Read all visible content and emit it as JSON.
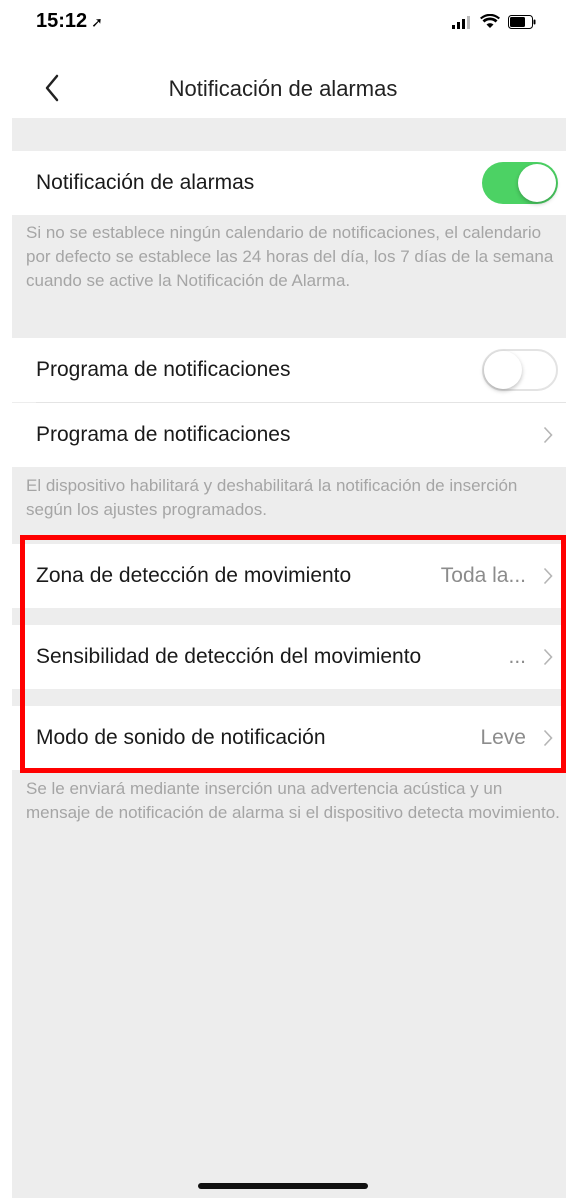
{
  "status_bar": {
    "time": "15:12",
    "location_arrow": "➚"
  },
  "nav": {
    "title": "Notificación de alarmas",
    "back_icon": "chevron-left-icon"
  },
  "sections": {
    "alarm_notification": {
      "label": "Notificación de alarmas",
      "toggle_on": true
    },
    "alarm_note": "Si no se establece ningún calendario de notificaciones, el calendario por defecto se establece las 24 horas del día, los 7 días de la semana cuando se active la Notificación de Alarma.",
    "schedule_toggle": {
      "label": "Programa de notificaciones",
      "toggle_on": false
    },
    "schedule_link": {
      "label": "Programa de notificaciones"
    },
    "schedule_note": "El dispositivo habilitará y deshabilitará la notificación de inserción según los ajustes programados.",
    "motion_zone": {
      "label": "Zona de detección de movimiento",
      "value": "Toda la..."
    },
    "motion_sensitivity": {
      "label": "Sensibilidad de detección del movimiento",
      "value": "..."
    },
    "sound_mode": {
      "label": "Modo de sonido de notificación",
      "value": "Leve"
    },
    "sound_note": "Se le enviará mediante inserción una advertencia acústica y un mensaje de notificación de alarma si el dispositivo detecta movimiento."
  },
  "colors": {
    "toggle_on": "#4cd264",
    "highlight": "#ff0000",
    "background": "#ededed"
  }
}
